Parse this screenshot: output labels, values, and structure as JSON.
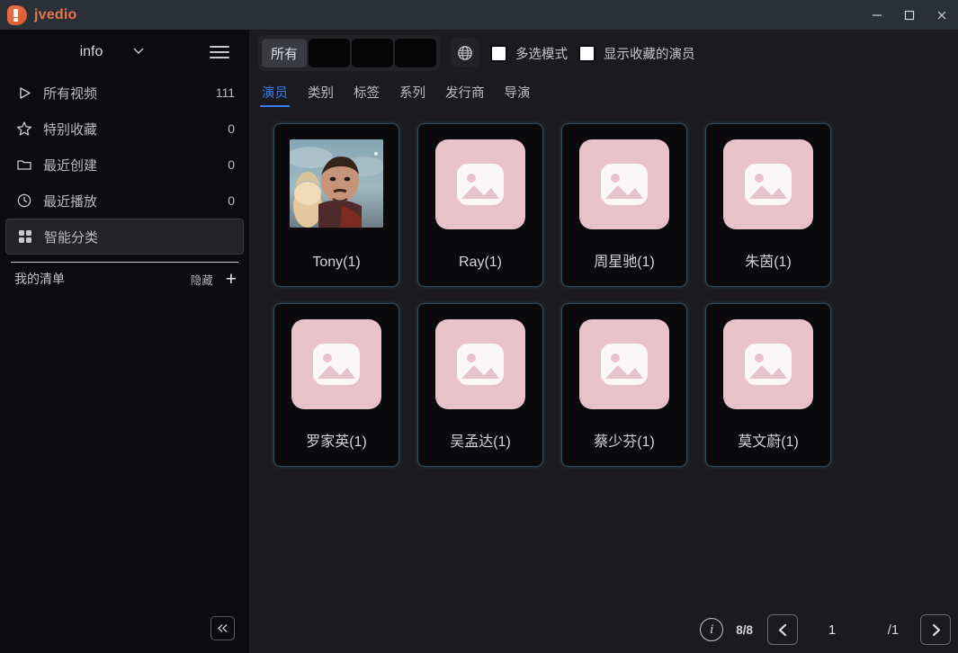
{
  "titlebar": {
    "app_name": "jvedio",
    "logo_icon": "jvedio-logo-icon",
    "minimize_icon": "minimize-icon",
    "maximize_icon": "maximize-icon",
    "close_icon": "close-icon"
  },
  "sidebar": {
    "database_name": "info",
    "dropdown_icon": "chevron-down-icon",
    "menu_icon": "hamburger-menu-icon",
    "items": [
      {
        "icon": "play-triangle-icon",
        "label": "所有视频",
        "count": "111",
        "selected": false
      },
      {
        "icon": "star-icon",
        "label": "特别收藏",
        "count": "0",
        "selected": false
      },
      {
        "icon": "folder-icon",
        "label": "最近创建",
        "count": "0",
        "selected": false
      },
      {
        "icon": "clock-icon",
        "label": "最近播放",
        "count": "0",
        "selected": false
      },
      {
        "icon": "grid-dots-icon",
        "label": "智能分类",
        "count": "",
        "selected": true
      }
    ],
    "mylist": {
      "label": "我的清单",
      "hide_label": "隐藏",
      "add_icon": "plus-icon"
    },
    "collapse_icon": "double-chevron-left-icon"
  },
  "toolbar": {
    "segmented": [
      {
        "label": "所有",
        "active": true,
        "redacted": false
      },
      {
        "label": "",
        "active": false,
        "redacted": true
      },
      {
        "label": "",
        "active": false,
        "redacted": true
      },
      {
        "label": "",
        "active": false,
        "redacted": true
      }
    ],
    "globe_icon": "globe-icon",
    "checkboxes": [
      {
        "label": "多选模式",
        "checked": false
      },
      {
        "label": "显示收藏的演员",
        "checked": false
      }
    ]
  },
  "tabs": [
    {
      "label": "演员",
      "active": true
    },
    {
      "label": "类别",
      "active": false
    },
    {
      "label": "标签",
      "active": false
    },
    {
      "label": "系列",
      "active": false
    },
    {
      "label": "发行商",
      "active": false
    },
    {
      "label": "导演",
      "active": false
    }
  ],
  "cards": [
    {
      "name": "Tony(1)",
      "thumb": "photo",
      "placeholder_icon": "image-placeholder-icon"
    },
    {
      "name": "Ray(1)",
      "thumb": "placeholder",
      "placeholder_icon": "image-placeholder-icon"
    },
    {
      "name": "周星驰(1)",
      "thumb": "placeholder",
      "placeholder_icon": "image-placeholder-icon"
    },
    {
      "name": "朱茵(1)",
      "thumb": "placeholder",
      "placeholder_icon": "image-placeholder-icon"
    },
    {
      "name": "罗家英(1)",
      "thumb": "placeholder",
      "placeholder_icon": "image-placeholder-icon"
    },
    {
      "name": "吴孟达(1)",
      "thumb": "placeholder",
      "placeholder_icon": "image-placeholder-icon"
    },
    {
      "name": "蔡少芬(1)",
      "thumb": "placeholder",
      "placeholder_icon": "image-placeholder-icon"
    },
    {
      "name": "莫文蔚(1)",
      "thumb": "placeholder",
      "placeholder_icon": "image-placeholder-icon"
    }
  ],
  "pagination": {
    "info_icon": "info-circle-icon",
    "count_ratio": "8/8",
    "prev_icon": "chevron-left-icon",
    "current_page": "1",
    "total_pages": "/1",
    "next_icon": "chevron-right-icon"
  },
  "colors": {
    "brand_orange": "#e8744a",
    "accent_blue": "#3e7cf0",
    "card_border": "#2d4d63",
    "placeholder_pink": "#e8c2ca",
    "sidebar_bg": "#0c0c0e",
    "main_bg": "#1b1b1f",
    "titlebar_bg": "#2b2f38"
  }
}
